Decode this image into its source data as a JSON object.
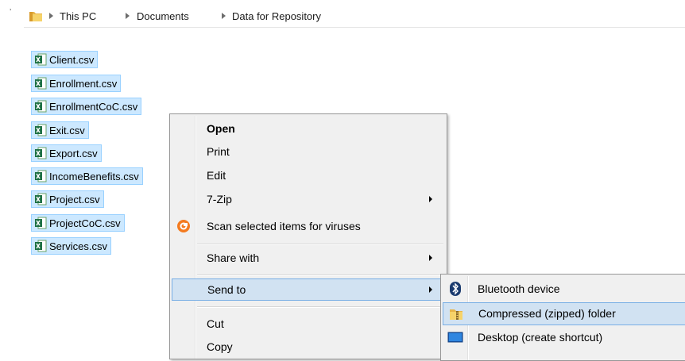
{
  "breadcrumb": {
    "items": [
      "This PC",
      "Documents",
      "Data for Repository"
    ]
  },
  "files": [
    {
      "name": "Client.csv"
    },
    {
      "name": "Enrollment.csv"
    },
    {
      "name": "EnrollmentCoC.csv"
    },
    {
      "name": "Exit.csv"
    },
    {
      "name": "Export.csv"
    },
    {
      "name": "IncomeBenefits.csv"
    },
    {
      "name": "Project.csv"
    },
    {
      "name": "ProjectCoC.csv"
    },
    {
      "name": "Services.csv"
    }
  ],
  "context_menu": {
    "items": [
      {
        "label": "Open",
        "bold": true
      },
      {
        "label": "Print"
      },
      {
        "label": "Edit"
      },
      {
        "label": "7-Zip",
        "submenu": true
      },
      {
        "label": "Scan selected items for viruses",
        "icon": "antivirus-icon"
      },
      {
        "label": "Share with",
        "submenu": true
      },
      {
        "label": "Send to",
        "submenu": true,
        "highlighted": true
      },
      {
        "label": "Cut"
      },
      {
        "label": "Copy"
      }
    ]
  },
  "send_to_menu": {
    "items": [
      {
        "label": "Bluetooth device",
        "icon": "bluetooth-icon"
      },
      {
        "label": "Compressed (zipped) folder",
        "icon": "zip-folder-icon",
        "highlighted": true
      },
      {
        "label": "Desktop (create shortcut)",
        "icon": "desktop-icon"
      }
    ]
  },
  "colors": {
    "selection_fill": "#cce8ff",
    "selection_border": "#99d1ff",
    "menu_bg": "#f0f0f0",
    "menu_hover": "#d1e2f2",
    "menu_hover_border": "#78aee5"
  }
}
